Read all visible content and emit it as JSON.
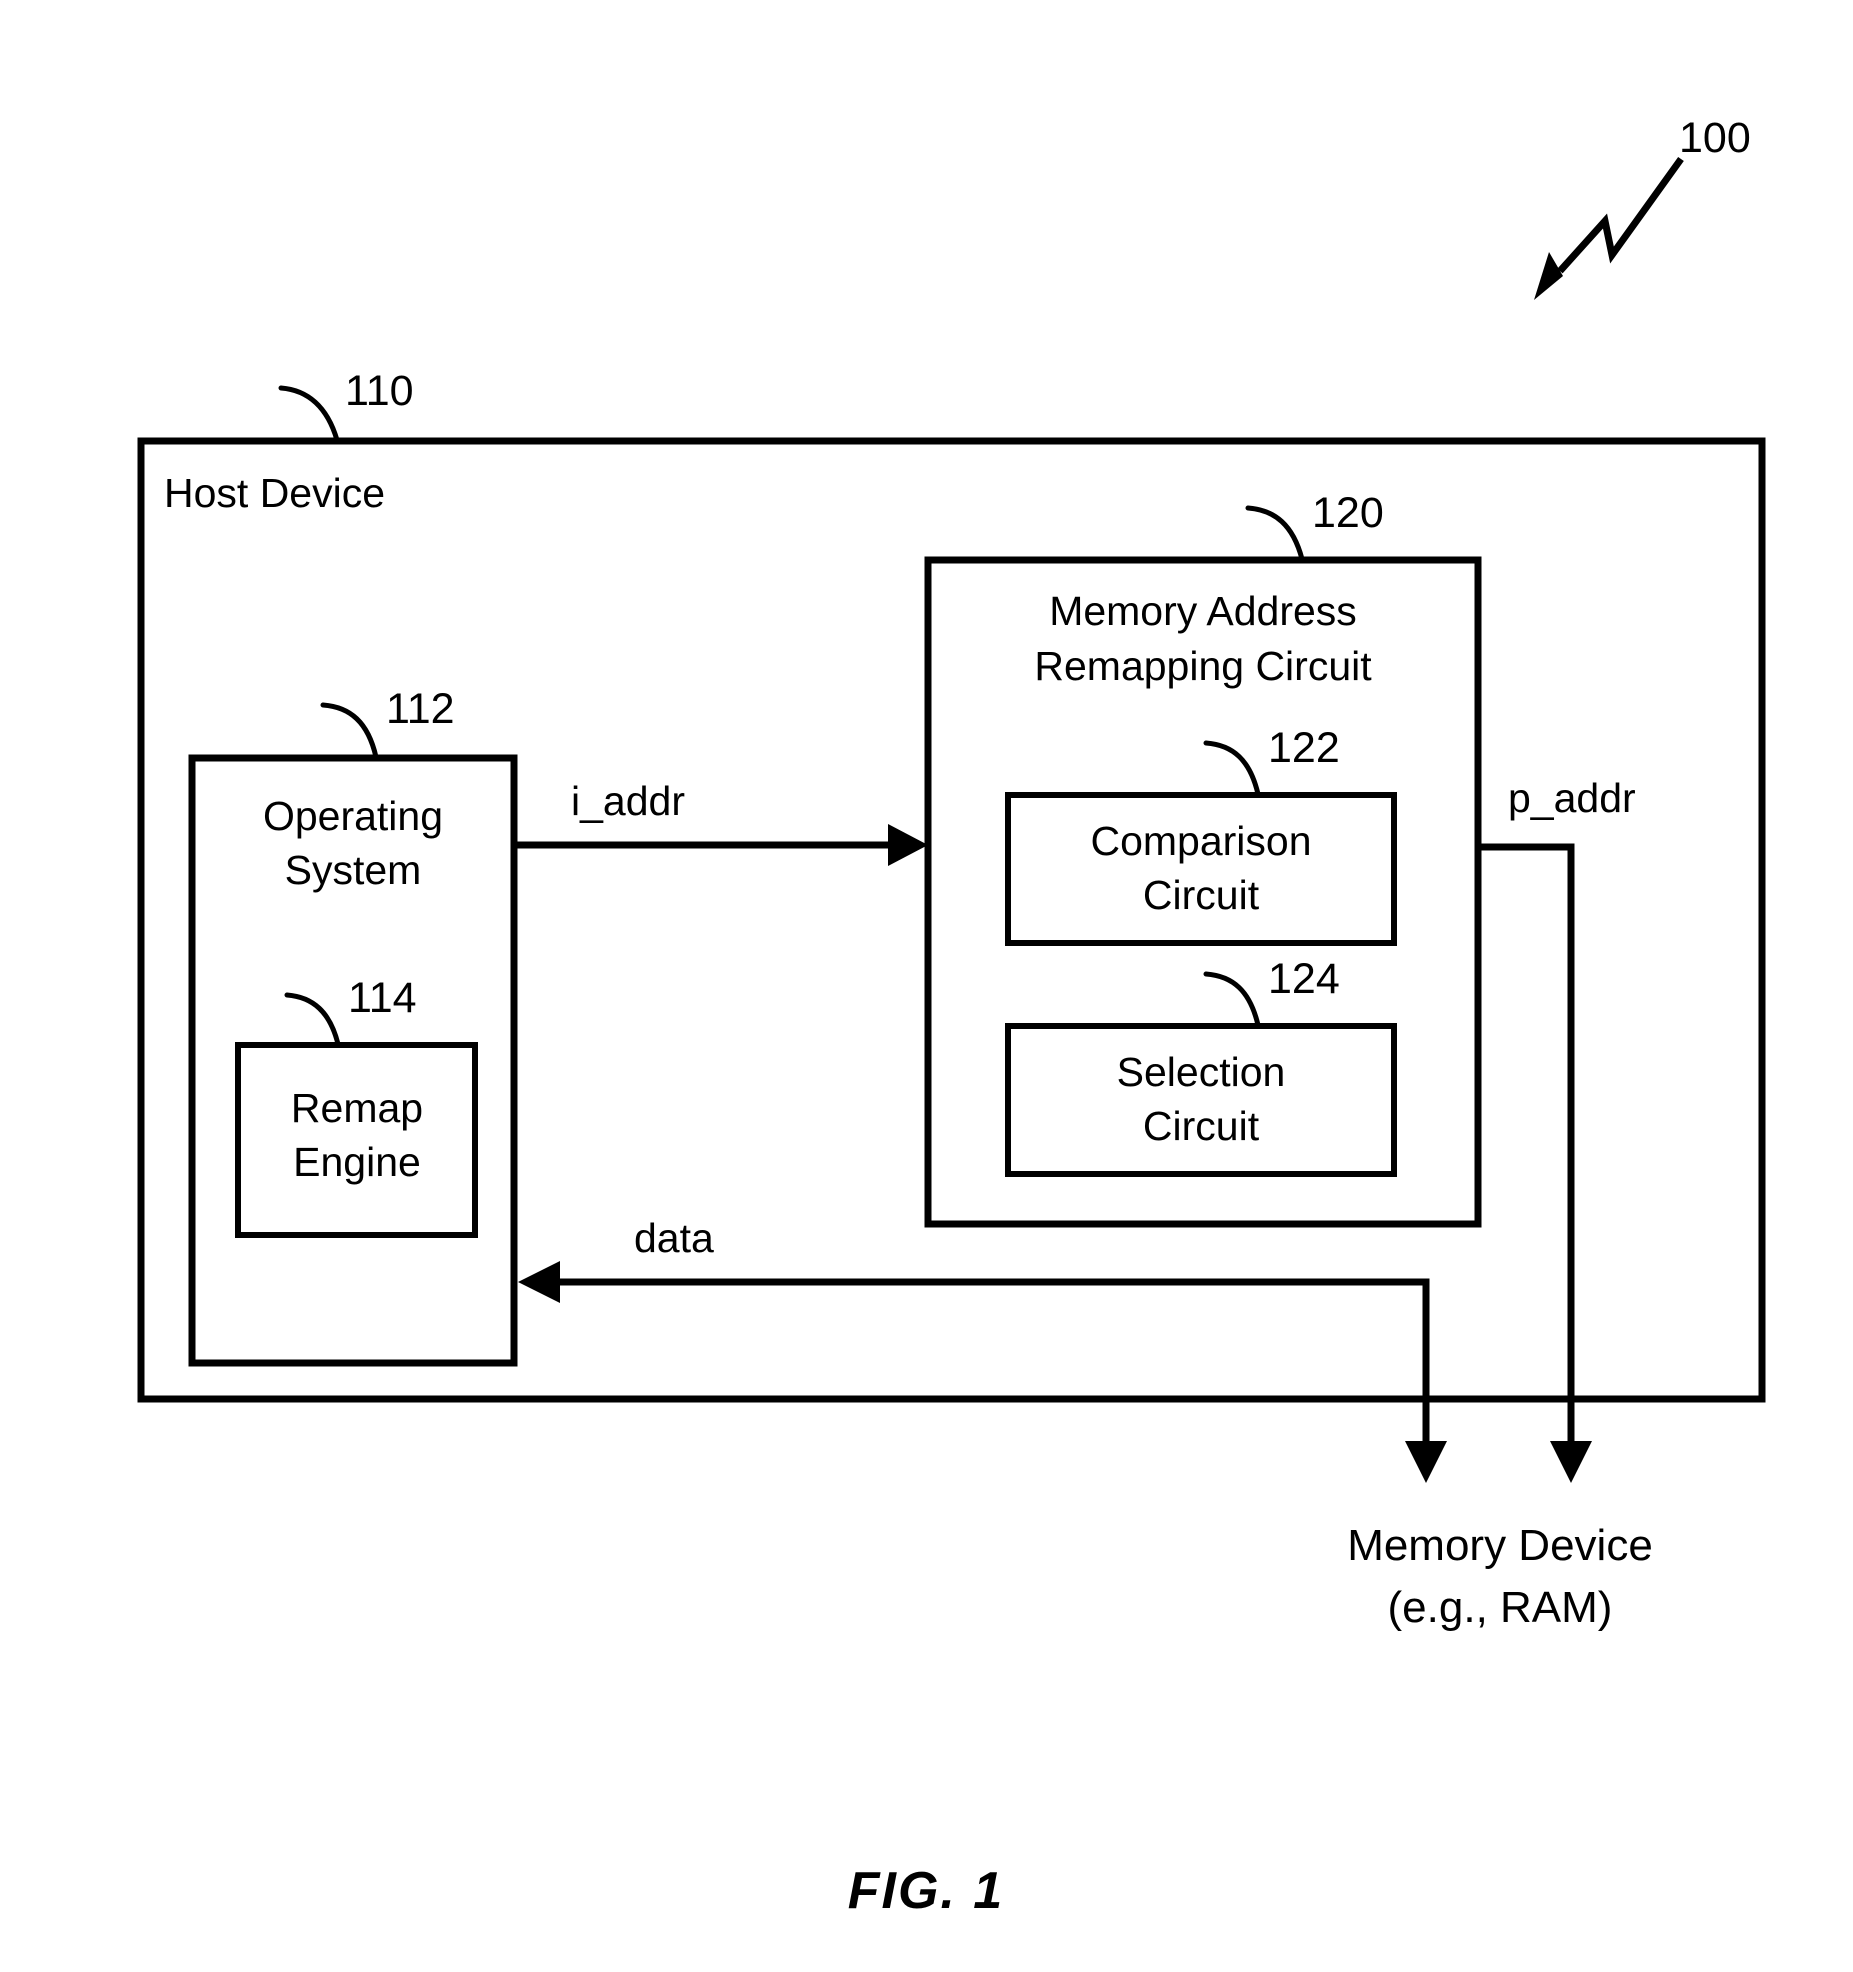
{
  "figure": {
    "caption": "FIG. 1",
    "overall_ref": "100"
  },
  "blocks": {
    "host_device": {
      "label": "Host Device",
      "ref": "110"
    },
    "operating_system": {
      "label_line1": "Operating",
      "label_line2": "System",
      "ref": "112"
    },
    "remap_engine": {
      "label_line1": "Remap",
      "label_line2": "Engine",
      "ref": "114"
    },
    "memory_address_remapping_circuit": {
      "label_line1": "Memory Address",
      "label_line2": "Remapping Circuit",
      "ref": "120"
    },
    "comparison_circuit": {
      "label_line1": "Comparison",
      "label_line2": "Circuit",
      "ref": "122"
    },
    "selection_circuit": {
      "label_line1": "Selection",
      "label_line2": "Circuit",
      "ref": "124"
    },
    "memory_device": {
      "label_line1": "Memory Device",
      "label_line2": "(e.g., RAM)"
    }
  },
  "signals": {
    "i_addr": "i_addr",
    "p_addr": "p_addr",
    "data": "data"
  },
  "colors": {
    "ink": "#000000",
    "paper": "#ffffff"
  }
}
